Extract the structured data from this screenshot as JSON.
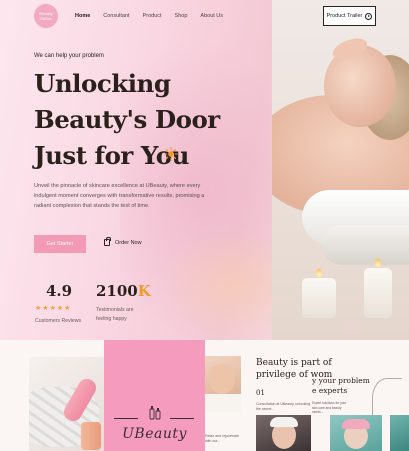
{
  "nav": {
    "logo_text": "Beauty Salon",
    "items": [
      "Home",
      "Consultant",
      "Product",
      "Shop",
      "About Us"
    ],
    "trailer_label": "Product Trailer"
  },
  "hero": {
    "eyebrow": "We can help your problem",
    "headline_lines": [
      "Unlocking",
      "Beauty's Door",
      "Just for You"
    ],
    "description": "Unveil the pinnacle of skincare excellence at UBeauty, where every indulgent moment converges with transformative results, promising a radiant complexion that stands the test of time.",
    "cta_primary": "Get Starter",
    "cta_secondary": "Order Now"
  },
  "stats": {
    "rating": "4.9",
    "rating_label": "Customers Reviews",
    "stars": 5,
    "count_main": "2100",
    "count_suffix": "K",
    "count_label": "Testimonials are feeling happy"
  },
  "lower": {
    "brand_name": "UBeauty",
    "title_lines": [
      "Beauty is part of",
      "privilege of wom"
    ],
    "step_number": "01",
    "step_text": "Consultation at UBeauty, unlocking the secret...",
    "side_title_lines": [
      "y your problem",
      "e experts"
    ],
    "side_text": "Expert solutions for your skin care and beauty needs...",
    "face_caption": "Relax and rejuvenate with our..."
  },
  "colors": {
    "accent_pink": "#f39ab7",
    "brand_tile": "#f59bbd",
    "star": "#f3a13c",
    "dark_text": "#2b211c"
  },
  "icons": [
    "sun-icon",
    "play-icon",
    "bag-icon",
    "star-icon",
    "bottles-icon"
  ]
}
